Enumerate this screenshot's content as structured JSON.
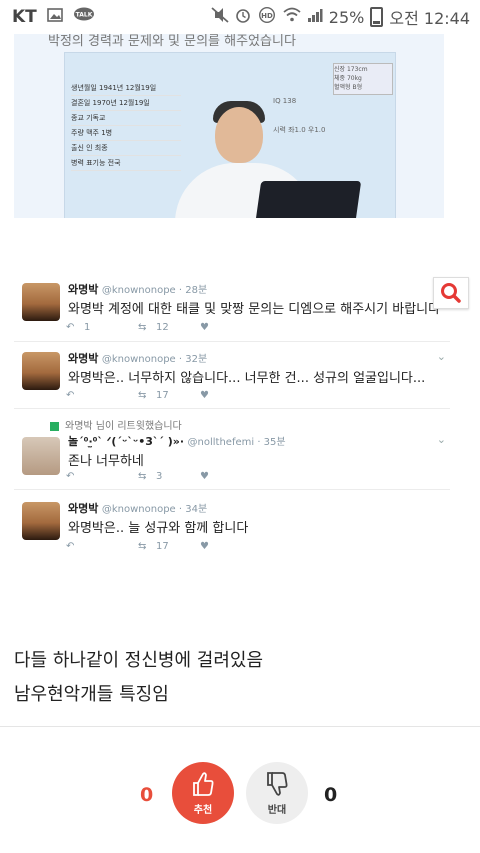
{
  "status_bar": {
    "carrier": "KT",
    "battery": "25%",
    "time": "오전 12:44",
    "icons": [
      "image-icon",
      "talk-icon",
      "mute-icon",
      "alarm-icon",
      "hd-icon",
      "wifi-icon",
      "signal-icon",
      "battery-icon"
    ]
  },
  "image_top": {
    "caption_text": "박정의 경력과 문제와 및 문의를 해주었습니다",
    "table_rows": [
      "생년월일 1941년 12월19일",
      "결혼일 1970년 12월19일",
      "종교 기독교",
      "주량 맥주 1병",
      "출신 인 최종",
      "병력 표기능 전국"
    ],
    "stats": [
      "신장 173cm",
      "체중 70kg",
      "혈액형 B형"
    ],
    "labels": [
      "IQ 138",
      "시력 좌1.0 우1.0"
    ]
  },
  "tweets": [
    {
      "name": "와명박",
      "handle": "@knownonope · 28분",
      "text": "와명박 계정에 대한 태클 및 맞짱 문의는 디엠으로 해주시기 바랍니다",
      "replies": "1",
      "retweets": "12",
      "likes": ""
    },
    {
      "name": "와명박",
      "handle": "@knownonope · 32분",
      "text": "와명박은.. 너무하지 않습니다... 너무한 건... 성규의 얼굴입니다...",
      "replies": "",
      "retweets": "17",
      "likes": ""
    },
    {
      "retweet_note": "와명박 님이 리트윗했습니다",
      "name": "놀ˊ⁰·̫⁰ˋ ᐟ(´ᵕ`ᵕ•3`ˊ )»·",
      "handle": "@nollthefemi · 35분",
      "text": "존나 너무하네",
      "replies": "",
      "retweets": "3",
      "likes": ""
    },
    {
      "name": "와명박",
      "handle": "@knownonope · 34분",
      "text": "와명박은.. 늘 성규와 함께 합니다",
      "replies": "",
      "retweets": "17",
      "likes": ""
    }
  ],
  "caption": {
    "line1": "다들 하나같이 정신병에 걸려있음",
    "line2": "남우현악개들 특징임"
  },
  "vote": {
    "up_count": "0",
    "down_count": "0",
    "up_label": "추천",
    "down_label": "반대",
    "up_color": "#e84e3b"
  }
}
